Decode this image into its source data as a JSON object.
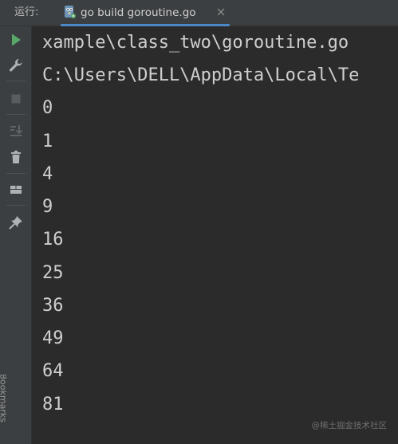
{
  "run_panel": {
    "label": "运行:",
    "tab": {
      "title": "go build goroutine.go",
      "icon": "gopher-file-icon",
      "close_icon": "close-icon"
    }
  },
  "toolbar": {
    "items": [
      {
        "name": "rerun-icon",
        "color": "#59a869"
      },
      {
        "name": "wrench-icon",
        "color": "#afb1b3"
      },
      {
        "name": "stop-icon",
        "color": "#5a5d60"
      },
      {
        "name": "scroll-to-end-icon",
        "color": "#5f6366"
      },
      {
        "name": "trash-icon",
        "color": "#afb1b3"
      },
      {
        "name": "layout-icon",
        "color": "#afb1b3"
      },
      {
        "name": "pin-icon",
        "color": "#afb1b3"
      }
    ],
    "side_label": "Bookmarks"
  },
  "console": {
    "lines": [
      "xample\\class_two\\goroutine.go",
      "C:\\Users\\DELL\\AppData\\Local\\Te",
      "0",
      "1",
      "4",
      "9",
      "16",
      "25",
      "36",
      "49",
      "64",
      "81"
    ]
  },
  "watermark": "@稀土掘金技术社区",
  "colors": {
    "background": "#2b2b2b",
    "panel": "#3c3f41",
    "text": "#cfcfcf",
    "accent": "#4a88c7",
    "run_green": "#59a869"
  }
}
